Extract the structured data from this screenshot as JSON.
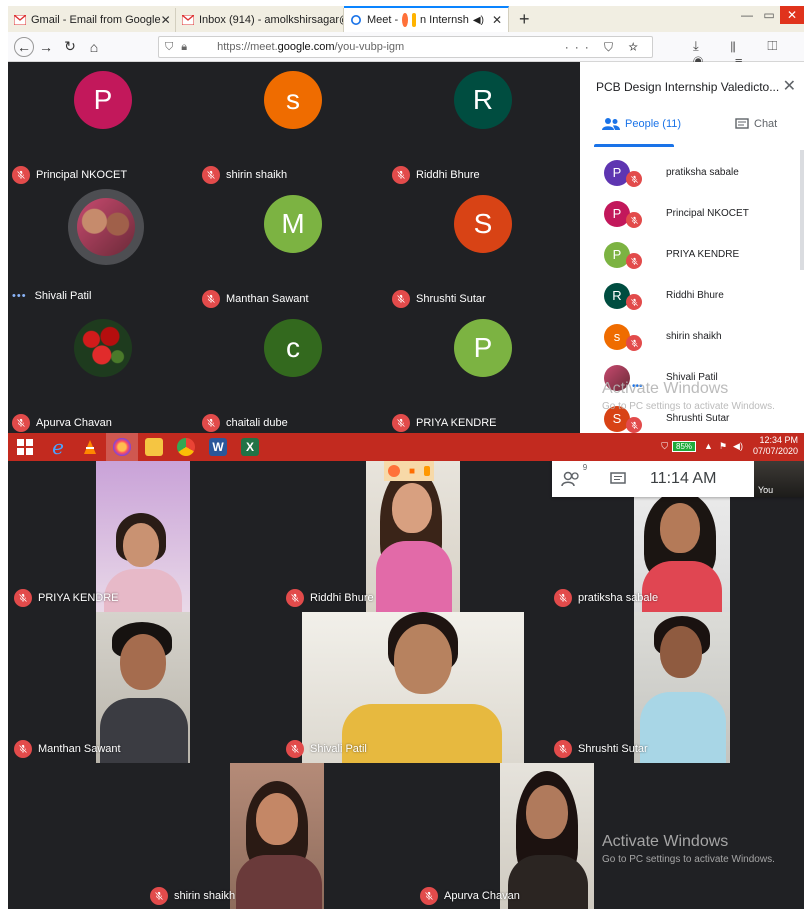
{
  "browser": {
    "tabs": [
      {
        "label": "Gmail - Email from Google",
        "close": "✕"
      },
      {
        "label": "Inbox (914) - amolkshirsagar@",
        "close": "✕"
      },
      {
        "label": "Meet - ",
        "close": ""
      },
      {
        "label": "n Internsh",
        "close": "✕"
      }
    ],
    "new_tab": "+",
    "url_prefix": "https://meet.",
    "url_domain": "google.com",
    "url_suffix": "/you-vubp-igm",
    "window_controls": {
      "minimize": "—",
      "maximize": "▭",
      "close": "✕"
    }
  },
  "top_meet": {
    "tiles": [
      {
        "name": "Principal NKOCET",
        "initial": "P",
        "color": "#c2185b",
        "status": "muted"
      },
      {
        "name": "shirin shaikh",
        "initial": "s",
        "color": "#ef6c00",
        "status": "muted"
      },
      {
        "name": "Riddhi Bhure",
        "initial": "R",
        "color": "#004d40",
        "status": "muted"
      },
      {
        "name": "Shivali Patil",
        "initial": "",
        "color": "",
        "status": "speaking"
      },
      {
        "name": "Manthan Sawant",
        "initial": "M",
        "color": "#7cb342",
        "status": "muted"
      },
      {
        "name": "Shrushti Sutar",
        "initial": "S",
        "color": "#d84315",
        "status": "muted"
      },
      {
        "name": "Apurva Chavan",
        "initial": "",
        "color": "",
        "status": "muted"
      },
      {
        "name": "chaitali dube",
        "initial": "c",
        "color": "#33691e",
        "status": "muted"
      },
      {
        "name": "PRIYA KENDRE",
        "initial": "P",
        "color": "#7cb342",
        "status": "muted"
      }
    ],
    "panel": {
      "title": "PCB Design Internship Valedicto...",
      "tab_people": "People (11)",
      "tab_chat": "Chat",
      "participants": [
        {
          "name": "pratiksha sabale",
          "initial": "P",
          "color": "#5e35b1"
        },
        {
          "name": "Principal NKOCET",
          "initial": "P",
          "color": "#c2185b"
        },
        {
          "name": "PRIYA KENDRE",
          "initial": "P",
          "color": "#7cb342"
        },
        {
          "name": "Riddhi Bhure",
          "initial": "R",
          "color": "#004d40"
        },
        {
          "name": "shirin shaikh",
          "initial": "s",
          "color": "#ef6c00"
        },
        {
          "name": "Shivali Patil",
          "initial": "",
          "color": ""
        },
        {
          "name": "Shrushti Sutar",
          "initial": "S",
          "color": "#d84315"
        }
      ]
    },
    "watermark_title": "Activate Windows",
    "watermark_sub": "Go to PC settings to activate Windows.",
    "taskbar": {
      "battery": "85%",
      "time": "12:34 PM",
      "date": "07/07/2020"
    }
  },
  "bottom_meet": {
    "time": "11:14 AM",
    "people_badge": "9",
    "you_label": "You",
    "tiles": [
      {
        "name": "PRIYA KENDRE"
      },
      {
        "name": "Riddhi Bhure"
      },
      {
        "name": "pratiksha sabale"
      },
      {
        "name": "Manthan Sawant"
      },
      {
        "name": "Shivali Patil"
      },
      {
        "name": "Shrushti Sutar"
      },
      {
        "name": "shirin shaikh"
      },
      {
        "name": "Apurva Chavan"
      }
    ],
    "watermark_title": "Activate Windows",
    "watermark_sub": "Go to PC settings to activate Windows."
  }
}
